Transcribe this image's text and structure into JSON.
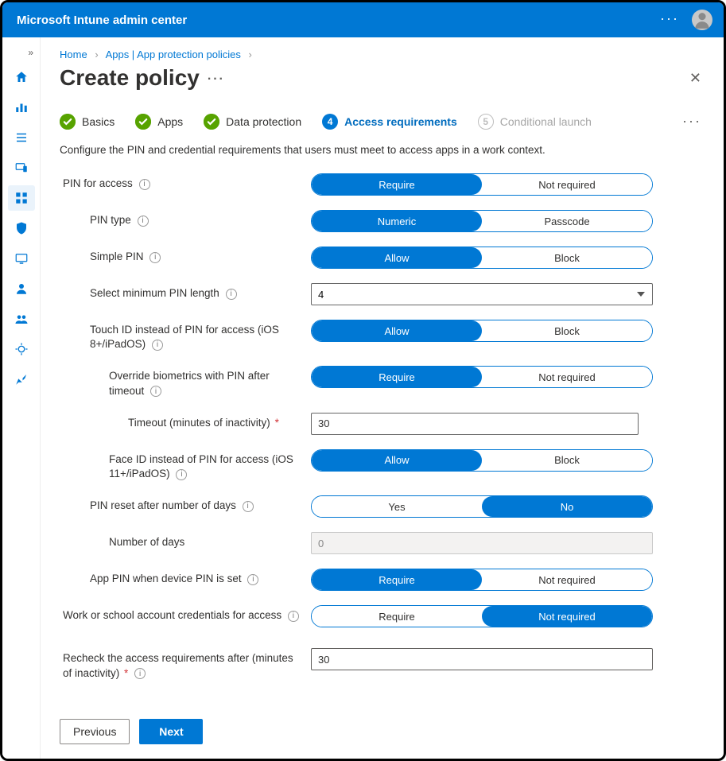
{
  "header": {
    "title": "Microsoft Intune admin center"
  },
  "breadcrumb": {
    "home": "Home",
    "apps": "Apps | App protection policies"
  },
  "page": {
    "title": "Create policy"
  },
  "steps": {
    "basics": "Basics",
    "apps": "Apps",
    "data_protection": "Data protection",
    "access_requirements_num": "4",
    "access_requirements": "Access requirements",
    "conditional_launch_num": "5",
    "conditional_launch": "Conditional launch"
  },
  "intro": "Configure the PIN and credential requirements that users must meet to access apps in a work context.",
  "labels": {
    "pin_for_access": "PIN for access",
    "pin_type": "PIN type",
    "simple_pin": "Simple PIN",
    "min_pin_length": "Select minimum PIN length",
    "touch_id": "Touch ID instead of PIN for access (iOS 8+/iPadOS)",
    "override_bio": "Override biometrics with PIN after timeout",
    "timeout": "Timeout (minutes of inactivity)",
    "face_id": "Face ID instead of PIN for access (iOS 11+/iPadOS)",
    "pin_reset": "PIN reset after number of days",
    "num_days": "Number of days",
    "app_pin_device": "App PIN when device PIN is set",
    "work_creds": "Work or school account credentials for access",
    "recheck": "Recheck the access requirements after (minutes of inactivity)"
  },
  "options": {
    "require": "Require",
    "not_required": "Not required",
    "numeric": "Numeric",
    "passcode": "Passcode",
    "allow": "Allow",
    "block": "Block",
    "yes": "Yes",
    "no": "No"
  },
  "values": {
    "min_pin_length": "4",
    "timeout": "30",
    "num_days": "0",
    "recheck": "30"
  },
  "buttons": {
    "previous": "Previous",
    "next": "Next"
  }
}
